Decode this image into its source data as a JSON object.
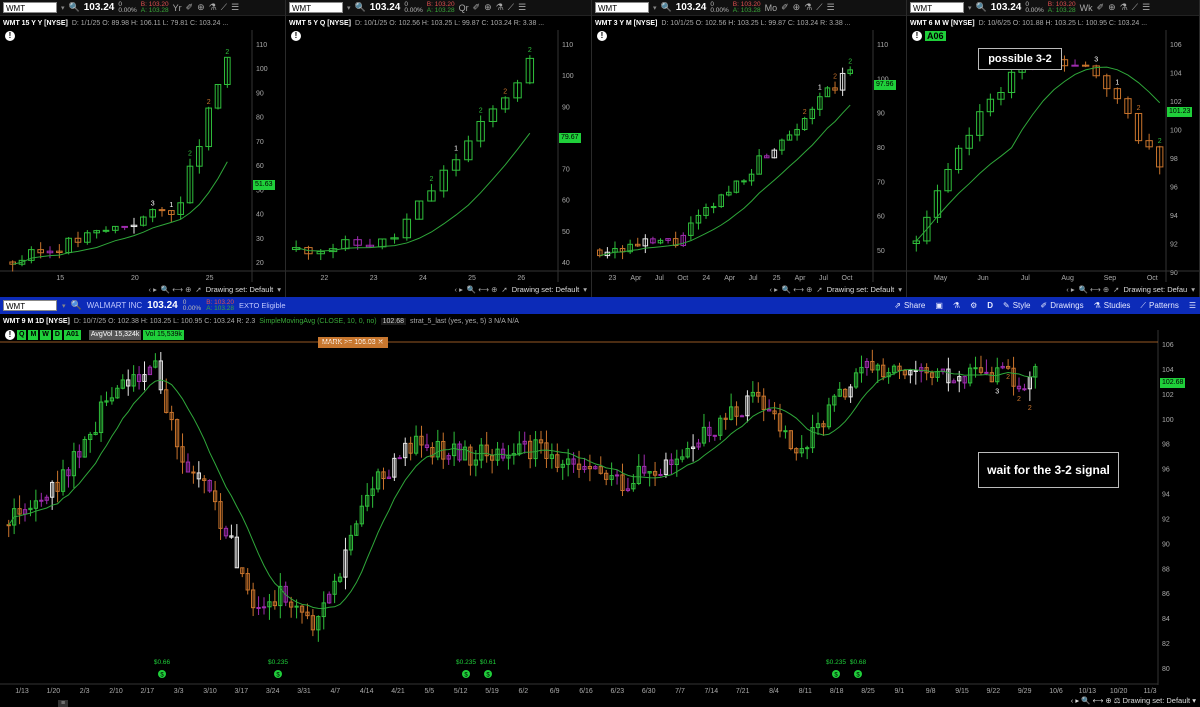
{
  "colors": {
    "up": "#2fbf3b",
    "down": "#c9742c",
    "inside": "#a02cb0",
    "outside_up": "#e8e8e8",
    "sma": "#2fa83a",
    "accent_blue": "#0c2bb8",
    "tag_green": "#1fcf3a"
  },
  "panels": [
    {
      "symbol": "WMT",
      "last": "103.24",
      "change": "0",
      "change_pct": "0.00%",
      "bid": "B: 103.20",
      "ask": "A: 103.28",
      "interval": "Yr",
      "title": "WMT 15 Y Y [NYSE]",
      "ohlc": "D: 1/1/25  O: 89.98  H: 106.11  L: 79.81  C: 103.24 ...",
      "price_tag": "51.63",
      "y_labels": [
        "110",
        "100",
        "90",
        "80",
        "70",
        "60",
        "50",
        "40",
        "30",
        "20"
      ],
      "x_labels": [
        "15",
        "20",
        "25"
      ],
      "drawing_set": "Drawing set: Default",
      "markers": [
        "2",
        "2",
        "2",
        "1",
        "3"
      ]
    },
    {
      "symbol": "WMT",
      "last": "103.24",
      "change": "0",
      "change_pct": "0.00%",
      "bid": "B: 103.20",
      "ask": "A: 103.28",
      "interval": "Qr",
      "title": "WMT 5 Y Q [NYSE]",
      "ohlc": "D: 10/1/25  O: 102.56  H: 103.25  L: 99.87  C: 103.24  R: 3.38 ...",
      "price_tag": "79.67",
      "y_labels": [
        "110",
        "100",
        "90",
        "80",
        "70",
        "60",
        "50",
        "40"
      ],
      "x_labels": [
        "22",
        "23",
        "24",
        "25",
        "26"
      ],
      "drawing_set": "Drawing set: Default",
      "markers": [
        "2",
        "2",
        "2",
        "1",
        "2"
      ]
    },
    {
      "symbol": "WMT",
      "last": "103.24",
      "change": "0",
      "change_pct": "0.00%",
      "bid": "B: 103.20",
      "ask": "A: 103.28",
      "interval": "Mo",
      "title": "WMT 3 Y M [NYSE]",
      "ohlc": "D: 10/1/25  O: 102.56  H: 103.25  L: 99.87  C: 103.24  R: 3.38 ...",
      "price_tag": "97.96",
      "y_labels": [
        "110",
        "100",
        "90",
        "80",
        "70",
        "60",
        "50"
      ],
      "x_labels": [
        "23",
        "Apr",
        "Jul",
        "Oct",
        "24",
        "Apr",
        "Jul",
        "25",
        "Apr",
        "Jul",
        "Oct"
      ],
      "drawing_set": "Drawing set: Default",
      "markers": [
        "2",
        "2",
        "1",
        "2"
      ]
    },
    {
      "symbol": "WMT",
      "last": "103.24",
      "change": "0",
      "change_pct": "0.00%",
      "bid": "B: 103.20",
      "ask": "A: 103.28",
      "interval": "Wk",
      "title": "WMT 6 M W [NYSE]",
      "ohlc": "D: 10/6/25  O: 101.88  H: 103.25  L: 100.95  C: 103.24 ...",
      "price_tag": "101.23",
      "badge": "A06",
      "annotation": "possible 3-2",
      "y_labels": [
        "106",
        "104",
        "102",
        "100",
        "98",
        "96",
        "94",
        "92",
        "90"
      ],
      "x_labels": [
        "May",
        "Jun",
        "Jul",
        "Aug",
        "Sep",
        "Oct"
      ],
      "drawing_set": "Drawing set: Defau",
      "markers": [
        "2",
        "2",
        "1",
        "3"
      ]
    }
  ],
  "main": {
    "symbol": "WMT",
    "company": "WALMART INC",
    "last": "103.24",
    "change": "0",
    "change_pct": "0.00%",
    "bid": "B: 103.20",
    "ask": "A: 103.28",
    "eligible": "EXTO Eligible",
    "share": "Share",
    "style": "Style",
    "drawings": "Drawings",
    "studies": "Studies",
    "patterns": "Patterns",
    "d_label": "D",
    "title": "WMT 9 M 1D [NYSE]",
    "ohlc": "D: 10/7/25  O: 102.38  H: 103.25  L: 100.95  C: 103.24  R: 2.3",
    "sma": "SimpleMovingAvg (CLOSE, 10, 0, no)",
    "sma_value": "102.68",
    "strat": "strat_5_last (yes, yes, 5)  3  N/A  N/A",
    "timeframes": [
      "Q",
      "M",
      "W",
      "D",
      "A01"
    ],
    "avgvol": "AvgVol 15,324k",
    "vol": "Vol 15,539k",
    "mark": "MARK >= 106.03",
    "price_tag": "102.68",
    "annotation": "wait for the 3-2 signal",
    "y_labels": [
      "106",
      "104",
      "102",
      "100",
      "98",
      "96",
      "94",
      "92",
      "90",
      "88",
      "86",
      "84",
      "82",
      "80"
    ],
    "x_labels": [
      "1/13",
      "1/20",
      "2/3",
      "2/10",
      "2/17",
      "3/3",
      "3/10",
      "3/17",
      "3/24",
      "3/31",
      "4/7",
      "4/14",
      "4/21",
      "5/5",
      "5/12",
      "5/19",
      "6/2",
      "6/9",
      "6/16",
      "6/23",
      "6/30",
      "7/7",
      "7/14",
      "7/21",
      "8/4",
      "8/11",
      "8/18",
      "8/25",
      "9/1",
      "9/8",
      "9/15",
      "9/22",
      "9/29",
      "10/6",
      "10/13",
      "10/20",
      "11/3"
    ],
    "dividends": [
      "$0.66",
      "$0.235",
      "$0.235",
      "$0.61",
      "$0.235",
      "$0.68"
    ],
    "drawing_set": "Drawing set: Default",
    "markers": [
      "2",
      "2",
      "2",
      "3"
    ]
  }
}
